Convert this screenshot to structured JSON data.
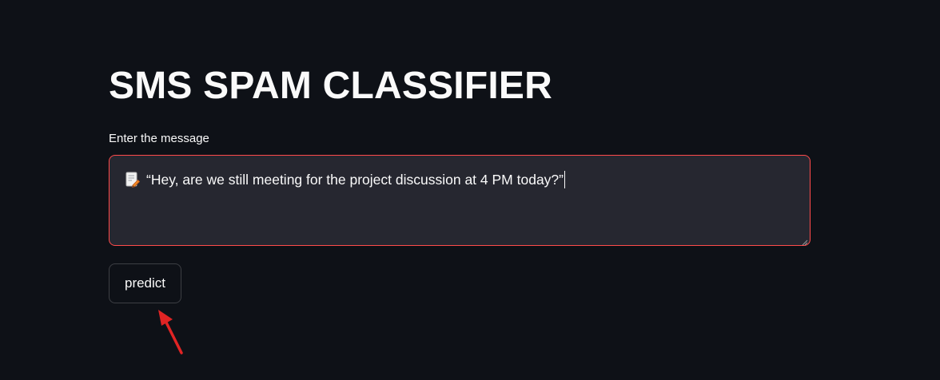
{
  "page": {
    "title": "SMS SPAM CLASSIFIER",
    "input_label": "Enter the message",
    "message_value": "“Hey, are we still meeting for the project discussion at 4 PM today?”",
    "predict_label": "predict"
  },
  "icons": {
    "message_prefix": "memo-icon",
    "annotation": "red-arrow-icon"
  },
  "colors": {
    "background": "#0e1117",
    "input_background": "#262730",
    "input_border_focus": "#ff4b4b",
    "text": "#fafafa",
    "annotation_arrow": "#e02424"
  }
}
